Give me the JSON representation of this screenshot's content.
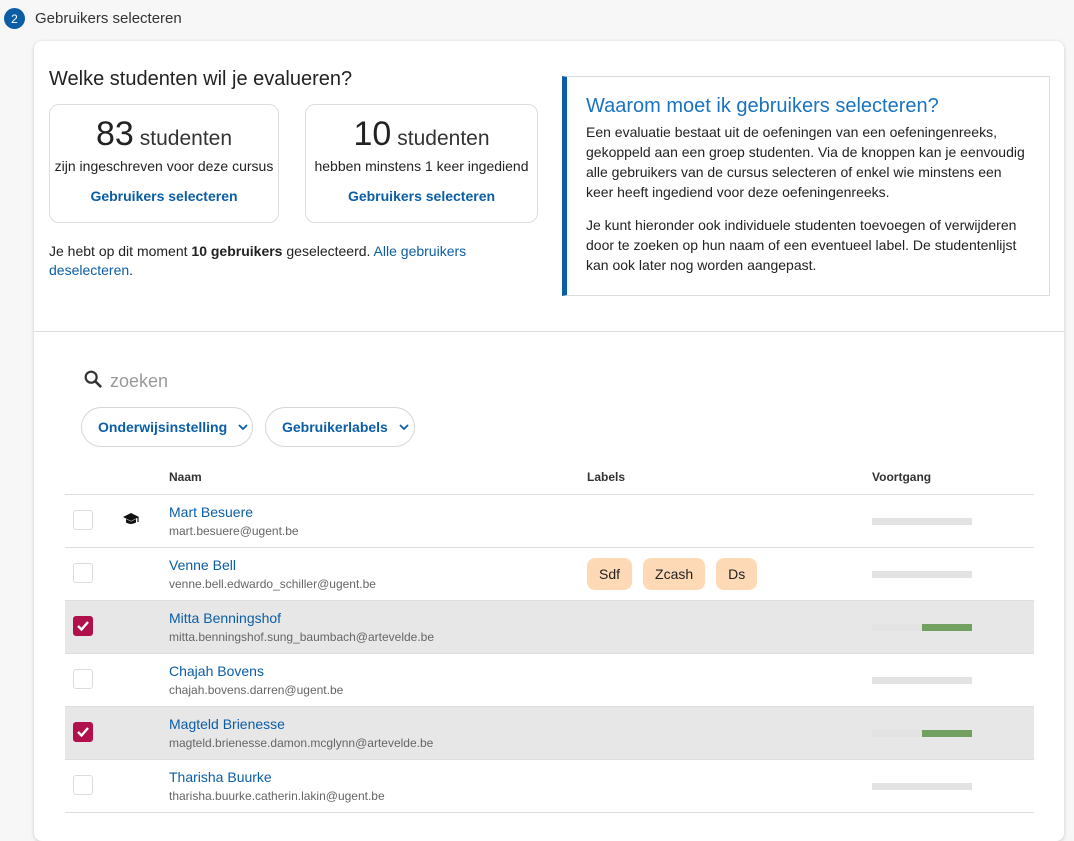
{
  "step": {
    "number": "2",
    "title": "Gebruikers selecteren"
  },
  "question": "Welke studenten wil je evalueren?",
  "stats": [
    {
      "count": "83",
      "unit": "studenten",
      "description": "zijn ingeschreven voor deze cursus",
      "link": "Gebruikers selecteren"
    },
    {
      "count": "10",
      "unit": "studenten",
      "description": "hebben minstens 1 keer ingediend",
      "link": "Gebruikers selecteren"
    }
  ],
  "selection": {
    "prefix": "Je hebt op dit moment ",
    "count_text": "10 gebruikers",
    "suffix": " geselecteerd. ",
    "deselect_link": "Alle gebruikers deselecteren",
    "end": "."
  },
  "info": {
    "title": "Waarom moet ik gebruikers selecteren?",
    "paragraph1": "Een evaluatie bestaat uit de oefeningen van een oefeningenreeks, gekoppeld aan een groep studenten. Via de knoppen kan je eenvoudig alle gebruikers van de cursus selecteren of enkel wie minstens een keer heeft ingediend voor deze oefeningenreeks.",
    "paragraph2": "Je kunt hieronder ook individuele studenten toevoegen of verwijderen door te zoeken op hun naam of een eventueel label. De studentenlijst kan ook later nog worden aangepast."
  },
  "search": {
    "placeholder": "zoeken"
  },
  "filters": {
    "institution": "Onderwijsinstelling",
    "labels": "Gebruikerlabels"
  },
  "table": {
    "headers": {
      "name": "Naam",
      "labels": "Labels",
      "progress": "Voortgang"
    },
    "rows": [
      {
        "name": "Mart Besuere",
        "email": "mart.besuere@ugent.be",
        "checked": false,
        "teacher": true,
        "labels": [],
        "progress": 0
      },
      {
        "name": "Venne Bell",
        "email": "venne.bell.edwardo_schiller@ugent.be",
        "checked": false,
        "teacher": false,
        "labels": [
          "Sdf",
          "Zcash",
          "Ds"
        ],
        "progress": 0
      },
      {
        "name": "Mitta Benningshof",
        "email": "mitta.benningshof.sung_baumbach@artevelde.be",
        "checked": true,
        "teacher": false,
        "labels": [],
        "progress": 0.5
      },
      {
        "name": "Chajah Bovens",
        "email": "chajah.bovens.darren@ugent.be",
        "checked": false,
        "teacher": false,
        "labels": [],
        "progress": 0
      },
      {
        "name": "Magteld Brienesse",
        "email": "magteld.brienesse.damon.mcglynn@artevelde.be",
        "checked": true,
        "teacher": false,
        "labels": [],
        "progress": 0.5
      },
      {
        "name": "Tharisha Buurke",
        "email": "tharisha.buurke.catherin.lakin@ugent.be",
        "checked": false,
        "teacher": false,
        "labels": [],
        "progress": 0
      }
    ]
  },
  "colors": {
    "accent": "#0b5ea6",
    "checkbox_checked": "#b0104b",
    "label_chip": "#fdd9b5",
    "progress_fill": "#72a060"
  }
}
